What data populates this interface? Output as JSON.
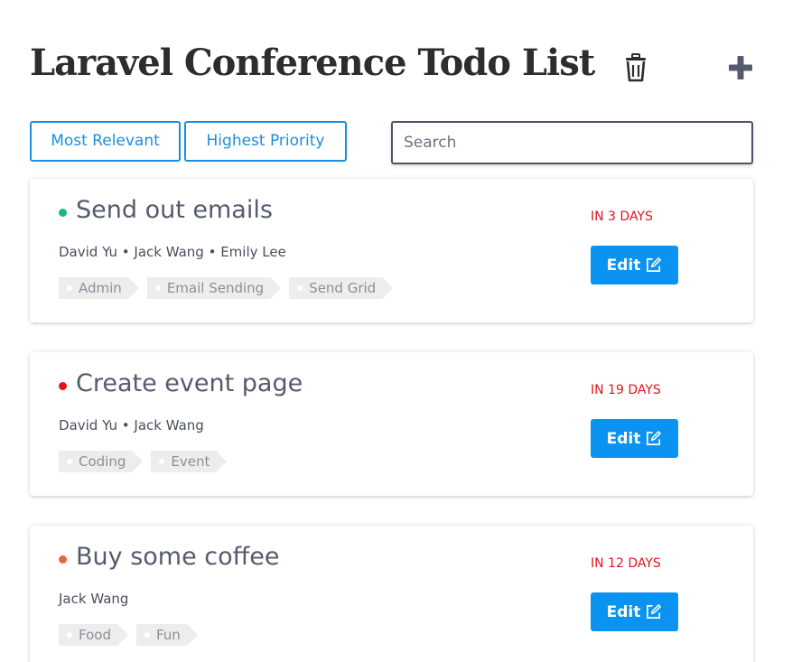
{
  "header": {
    "title": "Laravel Conference Todo List",
    "trash_icon": "trash-icon",
    "add_icon": "plus-icon"
  },
  "filters": {
    "most_relevant_label": "Most Relevant",
    "highest_priority_label": "Highest Priority"
  },
  "search": {
    "placeholder": "Search",
    "value": ""
  },
  "colors": {
    "accent": "#0a93f0",
    "due_text": "#e3141e",
    "priority_low": "#1cb879",
    "priority_high": "#e3141e",
    "priority_medium": "#f0643c"
  },
  "todos": [
    {
      "title": "Send out emails",
      "priority_color": "#1cb879",
      "assignees": "David Yu • Jack Wang • Emily Lee",
      "tags": [
        "Admin",
        "Email Sending",
        "Send Grid"
      ],
      "due": "IN 3 DAYS",
      "edit_label": "Edit"
    },
    {
      "title": "Create event page",
      "priority_color": "#e3141e",
      "assignees": "David Yu • Jack Wang",
      "tags": [
        "Coding",
        "Event"
      ],
      "due": "IN 19 DAYS",
      "edit_label": "Edit"
    },
    {
      "title": "Buy some coffee",
      "priority_color": "#f0643c",
      "assignees": "Jack Wang",
      "tags": [
        "Food",
        "Fun"
      ],
      "due": "IN 12 DAYS",
      "edit_label": "Edit"
    }
  ]
}
